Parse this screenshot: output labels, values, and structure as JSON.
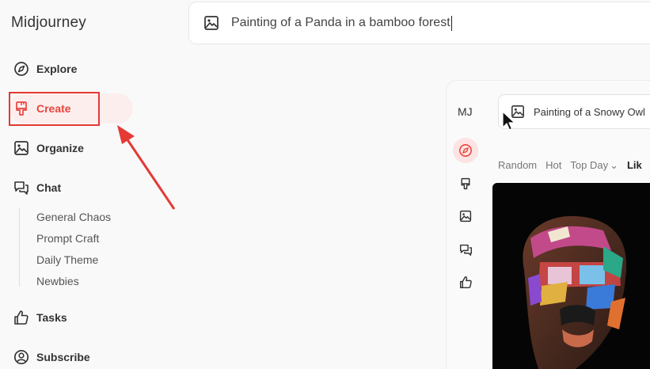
{
  "app": {
    "brand": "Midjourney"
  },
  "prompt": {
    "text": "Painting of a Panda in a bamboo forest"
  },
  "sidebar": {
    "items": [
      {
        "label": "Explore"
      },
      {
        "label": "Create"
      },
      {
        "label": "Organize"
      },
      {
        "label": "Chat"
      },
      {
        "label": "Tasks"
      },
      {
        "label": "Subscribe"
      }
    ],
    "chat_channels": [
      "General Chaos",
      "Prompt Craft",
      "Daily Theme",
      "Newbies"
    ]
  },
  "preview": {
    "logo": "MJ",
    "search_text": "Painting of a Snowy Owl",
    "filters": [
      "Random",
      "Hot",
      "Top Day",
      "Lik"
    ]
  },
  "colors": {
    "accent": "#e8453c",
    "highlight_box": "#e53935",
    "active_bg": "#fdeeee"
  },
  "icons": [
    "image-icon",
    "compass-icon",
    "brush-icon",
    "chat-icon",
    "thumbs-up-icon",
    "user-circle-icon",
    "cursor-icon",
    "arrow-annotation"
  ]
}
